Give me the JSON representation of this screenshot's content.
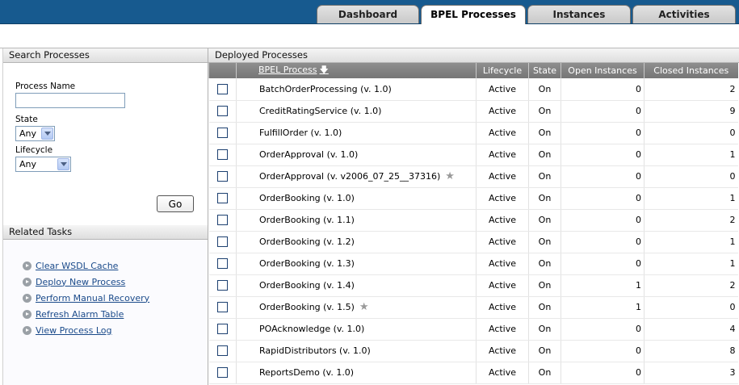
{
  "tabs": [
    {
      "label": "Dashboard",
      "active": false
    },
    {
      "label": "BPEL Processes",
      "active": true
    },
    {
      "label": "Instances",
      "active": false
    },
    {
      "label": "Activities",
      "active": false
    }
  ],
  "search": {
    "title": "Search Processes",
    "process_name_label": "Process Name",
    "process_name_value": "",
    "state_label": "State",
    "state_value": "Any",
    "lifecycle_label": "Lifecycle",
    "lifecycle_value": "Any",
    "go_label": "Go"
  },
  "tasks": {
    "title": "Related Tasks",
    "items": [
      "Clear WSDL Cache",
      "Deploy New Process",
      "Perform Manual Recovery",
      "Refresh Alarm Table",
      "View Process Log"
    ]
  },
  "deployed": {
    "title": "Deployed Processes",
    "columns": [
      "BPEL Process",
      "Lifecycle",
      "State",
      "Open Instances",
      "Closed Instances"
    ],
    "rows": [
      {
        "name": "BatchOrderProcessing (v. 1.0)",
        "lifecycle": "Active",
        "state": "On",
        "open": "0",
        "closed": "2",
        "starred": false
      },
      {
        "name": "CreditRatingService (v. 1.0)",
        "lifecycle": "Active",
        "state": "On",
        "open": "0",
        "closed": "9",
        "starred": false
      },
      {
        "name": "FulfillOrder (v. 1.0)",
        "lifecycle": "Active",
        "state": "On",
        "open": "0",
        "closed": "0",
        "starred": false
      },
      {
        "name": "OrderApproval (v. 1.0)",
        "lifecycle": "Active",
        "state": "On",
        "open": "0",
        "closed": "1",
        "starred": false
      },
      {
        "name": "OrderApproval (v. v2006_07_25__37316)",
        "lifecycle": "Active",
        "state": "On",
        "open": "0",
        "closed": "0",
        "starred": true
      },
      {
        "name": "OrderBooking (v. 1.0)",
        "lifecycle": "Active",
        "state": "On",
        "open": "0",
        "closed": "1",
        "starred": false
      },
      {
        "name": "OrderBooking (v. 1.1)",
        "lifecycle": "Active",
        "state": "On",
        "open": "0",
        "closed": "2",
        "starred": false
      },
      {
        "name": "OrderBooking (v. 1.2)",
        "lifecycle": "Active",
        "state": "On",
        "open": "0",
        "closed": "1",
        "starred": false
      },
      {
        "name": "OrderBooking (v. 1.3)",
        "lifecycle": "Active",
        "state": "On",
        "open": "0",
        "closed": "1",
        "starred": false
      },
      {
        "name": "OrderBooking (v. 1.4)",
        "lifecycle": "Active",
        "state": "On",
        "open": "1",
        "closed": "2",
        "starred": false
      },
      {
        "name": "OrderBooking (v. 1.5)",
        "lifecycle": "Active",
        "state": "On",
        "open": "1",
        "closed": "0",
        "starred": true
      },
      {
        "name": "POAcknowledge (v. 1.0)",
        "lifecycle": "Active",
        "state": "On",
        "open": "0",
        "closed": "4",
        "starred": false
      },
      {
        "name": "RapidDistributors (v. 1.0)",
        "lifecycle": "Active",
        "state": "On",
        "open": "0",
        "closed": "8",
        "starred": false
      },
      {
        "name": "ReportsDemo (v. 1.0)",
        "lifecycle": "Active",
        "state": "On",
        "open": "0",
        "closed": "3",
        "starred": false
      }
    ]
  },
  "colors": {
    "header_band": "#175a8f",
    "table_header": "#828282",
    "link": "#1a4a8a"
  },
  "icons": {
    "star": "star-icon",
    "task_arrow": "arrow-circle-icon",
    "sort": "sort-down-arrow-icon",
    "dropdown": "chevron-down-icon"
  }
}
